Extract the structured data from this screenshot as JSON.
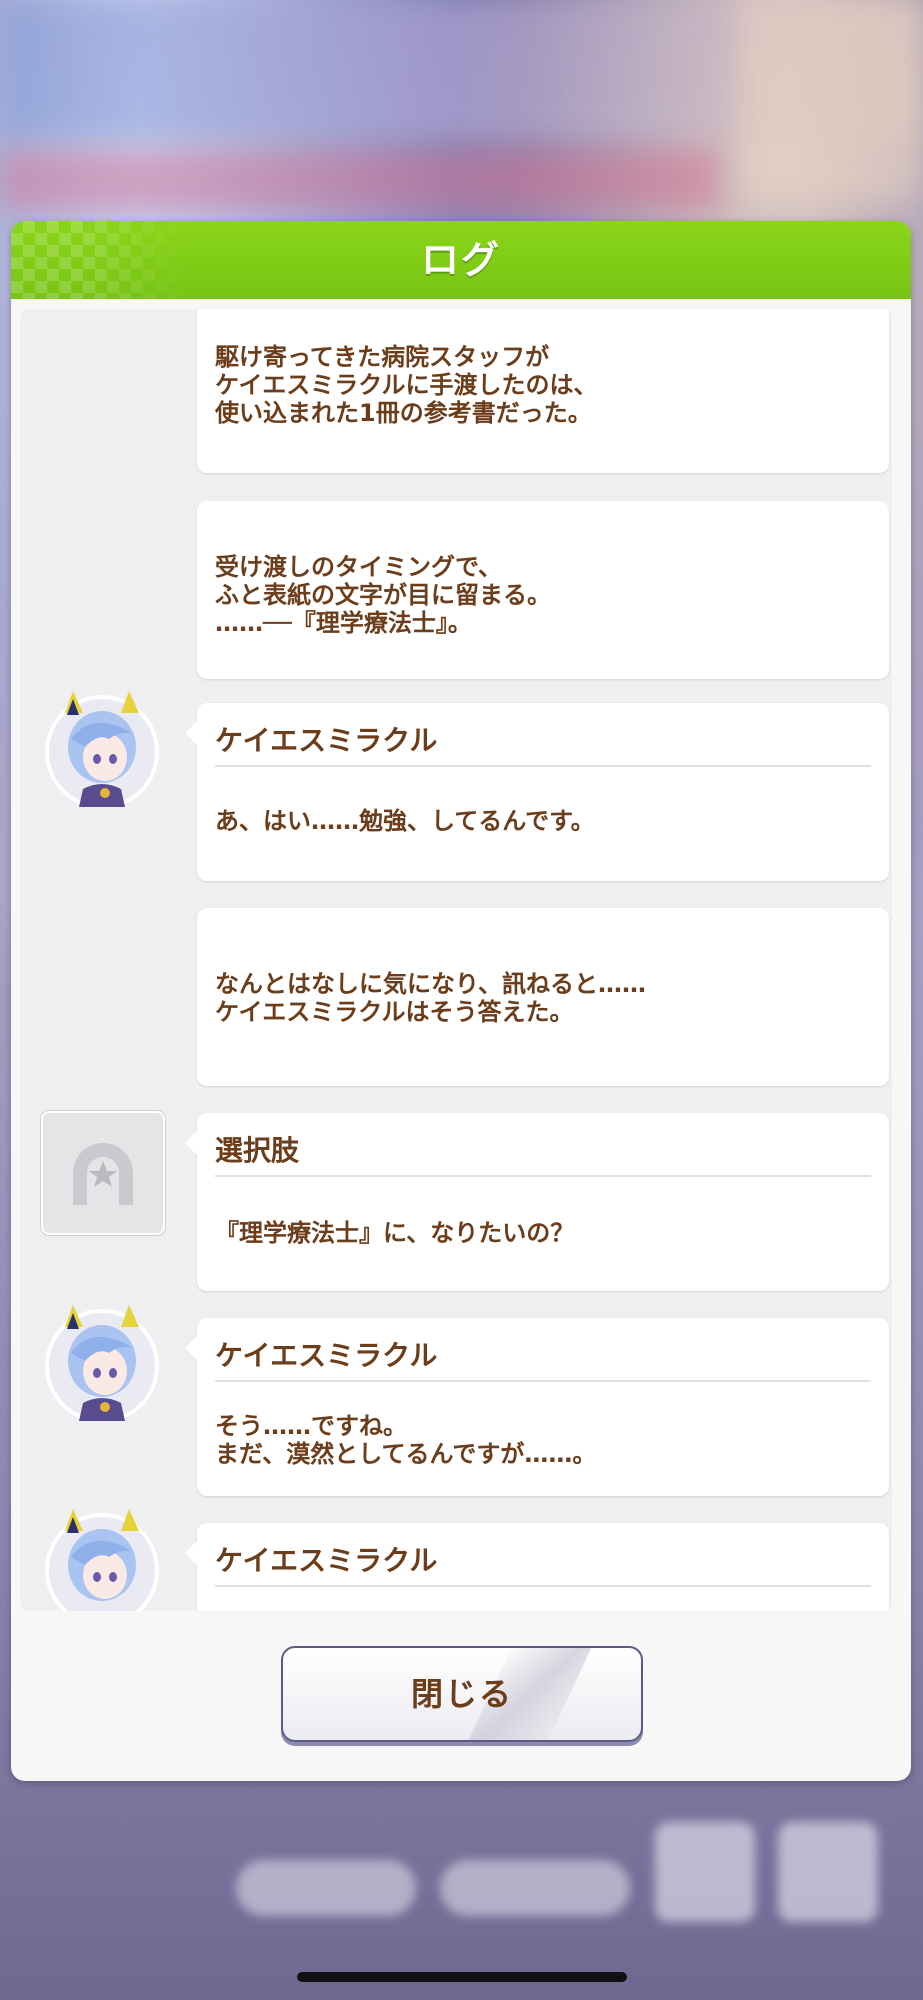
{
  "header": {
    "title": "ログ"
  },
  "log": [
    {
      "type": "narration",
      "text": "駆け寄ってきた病院スタッフが\nケイエスミラクルに手渡したのは、\n使い込まれた1冊の参考書だった。"
    },
    {
      "type": "narration",
      "text": "受け渡しのタイミングで、\nふと表紙の文字が目に留まる。\n……──『理学療法士』。"
    },
    {
      "type": "dialogue",
      "speaker": "ケイエスミラクル",
      "text": "あ、はい……勉強、してるんです。",
      "avatar": "keies-miracle-avatar"
    },
    {
      "type": "narration",
      "text": "なんとはなしに気になり、訊ねると……\nケイエスミラクルはそう答えた。"
    },
    {
      "type": "choice",
      "speaker": "選択肢",
      "text": "『理学療法士』に、なりたいの？",
      "avatar": "horseshoe-star-icon"
    },
    {
      "type": "dialogue",
      "speaker": "ケイエスミラクル",
      "text": "そう……ですね。\nまだ、漠然としてるんですが……。",
      "avatar": "keies-miracle-avatar"
    },
    {
      "type": "dialogue",
      "speaker": "ケイエスミラクル",
      "text": "",
      "avatar": "keies-miracle-avatar"
    }
  ],
  "footer": {
    "close_label": "閉じる"
  },
  "colors": {
    "header_green": "#84cf18",
    "text_brown": "#6b3d1a",
    "button_border": "#5b5a86"
  }
}
